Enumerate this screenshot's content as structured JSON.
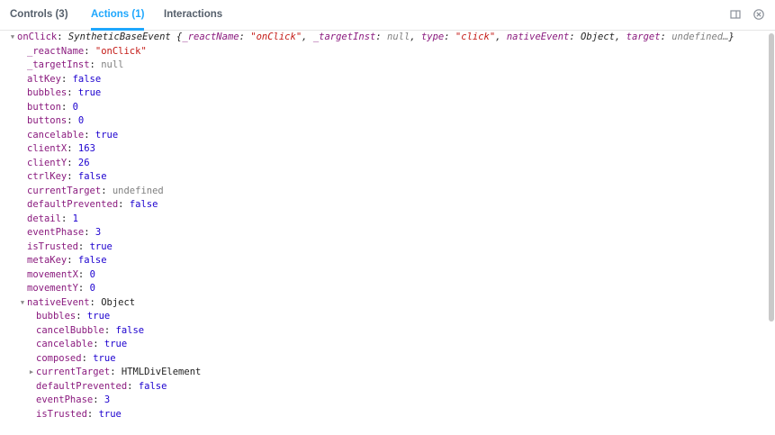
{
  "tabs": [
    {
      "label": "Controls (3)",
      "active": false
    },
    {
      "label": "Actions (1)",
      "active": true
    },
    {
      "label": "Interactions",
      "active": false
    }
  ],
  "toolbar": {
    "icons": [
      "panel-layout-icon",
      "clear-icon"
    ]
  },
  "inspector": {
    "root": {
      "key": "onClick",
      "preview_class": "SyntheticBaseEvent",
      "preview_pairs": [
        {
          "key": "_reactName",
          "value": "\"onClick\"",
          "kind": "str"
        },
        {
          "key": "_targetInst",
          "value": "null",
          "kind": "null"
        },
        {
          "key": "type",
          "value": "\"click\"",
          "kind": "str"
        },
        {
          "key": "nativeEvent",
          "value": "Object",
          "kind": "plain"
        },
        {
          "key": "target",
          "value": "undefined…",
          "kind": "null"
        }
      ],
      "preview_open": "{",
      "preview_close": "}"
    },
    "rows": [
      {
        "key": "_reactName",
        "value": "\"onClick\"",
        "kind": "str"
      },
      {
        "key": "_targetInst",
        "value": "null",
        "kind": "null"
      },
      {
        "key": "altKey",
        "value": "false",
        "kind": "bool"
      },
      {
        "key": "bubbles",
        "value": "true",
        "kind": "bool"
      },
      {
        "key": "button",
        "value": "0",
        "kind": "num"
      },
      {
        "key": "buttons",
        "value": "0",
        "kind": "num"
      },
      {
        "key": "cancelable",
        "value": "true",
        "kind": "bool"
      },
      {
        "key": "clientX",
        "value": "163",
        "kind": "num"
      },
      {
        "key": "clientY",
        "value": "26",
        "kind": "num"
      },
      {
        "key": "ctrlKey",
        "value": "false",
        "kind": "bool"
      },
      {
        "key": "currentTarget",
        "value": "undefined",
        "kind": "null"
      },
      {
        "key": "defaultPrevented",
        "value": "false",
        "kind": "bool"
      },
      {
        "key": "detail",
        "value": "1",
        "kind": "num"
      },
      {
        "key": "eventPhase",
        "value": "3",
        "kind": "num"
      },
      {
        "key": "isTrusted",
        "value": "true",
        "kind": "bool"
      },
      {
        "key": "metaKey",
        "value": "false",
        "kind": "bool"
      },
      {
        "key": "movementX",
        "value": "0",
        "kind": "num"
      },
      {
        "key": "movementY",
        "value": "0",
        "kind": "num"
      }
    ],
    "native_event": {
      "key": "nativeEvent",
      "value": "Object",
      "rows": [
        {
          "key": "bubbles",
          "value": "true",
          "kind": "bool"
        },
        {
          "key": "cancelBubble",
          "value": "false",
          "kind": "bool"
        },
        {
          "key": "cancelable",
          "value": "true",
          "kind": "bool"
        },
        {
          "key": "composed",
          "value": "true",
          "kind": "bool"
        },
        {
          "key": "currentTarget",
          "value": "HTMLDivElement",
          "kind": "plain",
          "expandable": true
        },
        {
          "key": "defaultPrevented",
          "value": "false",
          "kind": "bool"
        },
        {
          "key": "eventPhase",
          "value": "3",
          "kind": "num"
        },
        {
          "key": "isTrusted",
          "value": "true",
          "kind": "bool"
        }
      ]
    }
  },
  "colors": {
    "accent": "#1ea7fd",
    "key": "#8a1a7e",
    "string": "#c41a16",
    "number_bool": "#1c00cf",
    "null": "#808080"
  }
}
